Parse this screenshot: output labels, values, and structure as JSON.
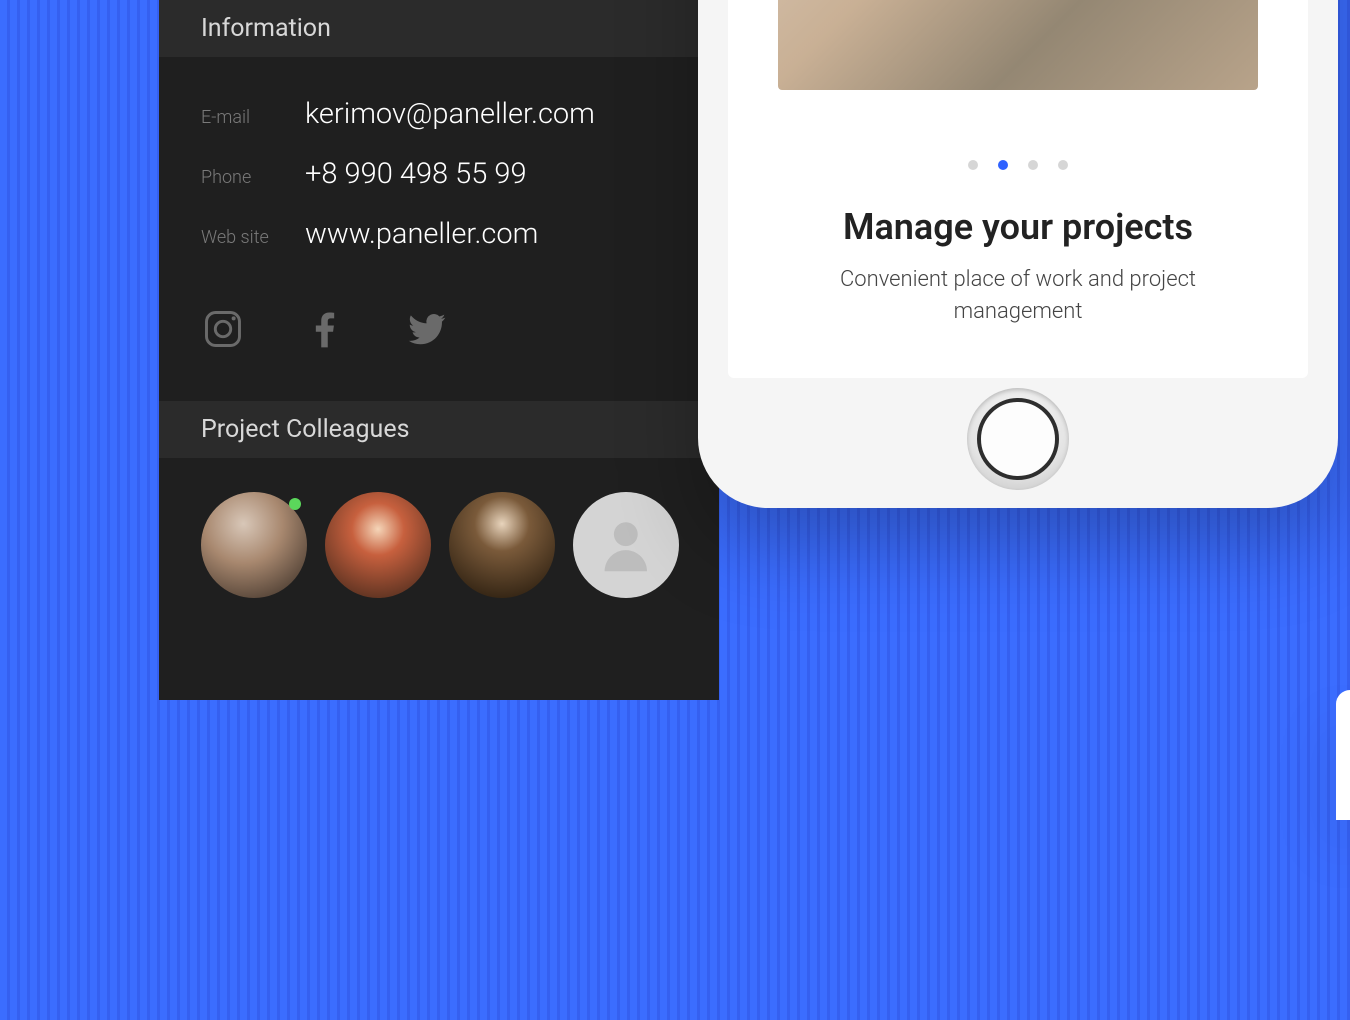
{
  "info": {
    "section_title": "Information",
    "email_label": "E-mail",
    "email_value": "kerimov@paneller.com",
    "phone_label": "Phone",
    "phone_value": "+8 990 498 55 99",
    "website_label": "Web site",
    "website_value": "www.paneller.com"
  },
  "colleagues": {
    "section_title": "Project Colleagues"
  },
  "onboarding": {
    "title": "Manage your projects",
    "subtitle": "Convenient place of work and project management"
  }
}
